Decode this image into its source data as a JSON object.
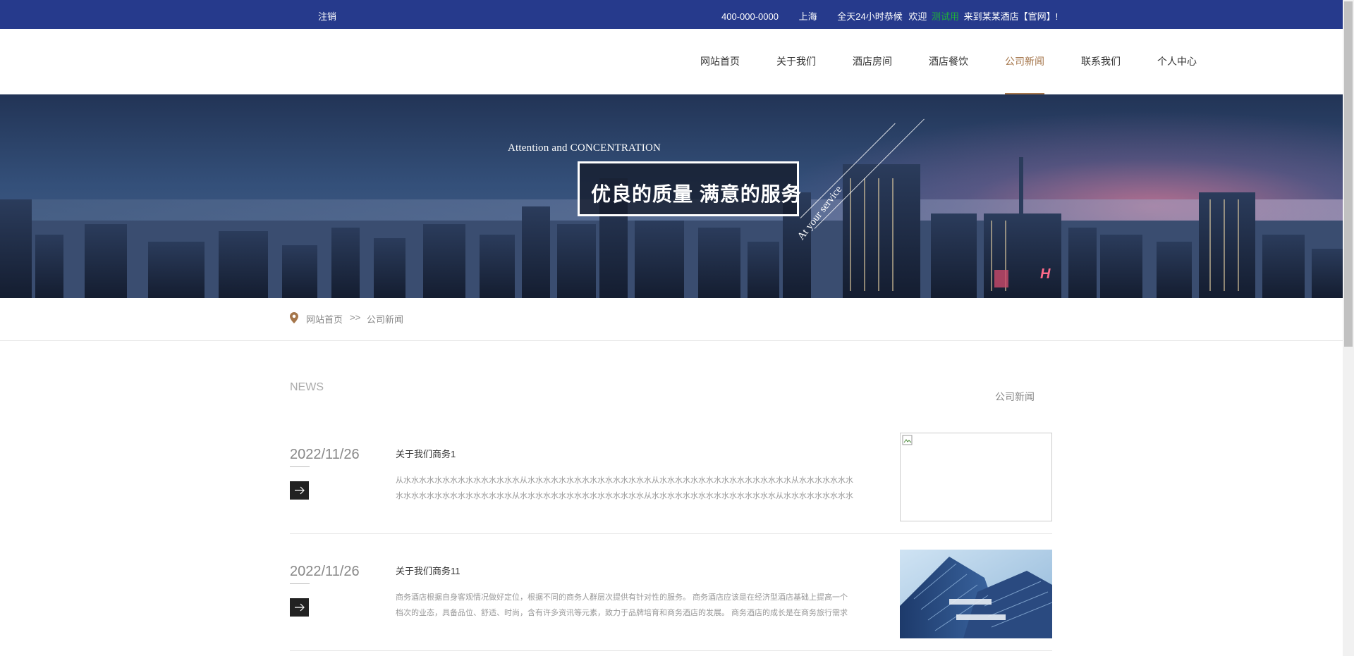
{
  "topbar": {
    "logout": "注销",
    "phone": "400-000-0000",
    "city": "上海",
    "service": "全天24小时恭候",
    "welcome_prefix": "欢迎",
    "username": "测试用",
    "welcome_suffix": "来到某某酒店【官网】!"
  },
  "nav": {
    "items": [
      "网站首页",
      "关于我们",
      "酒店房间",
      "酒店餐饮",
      "公司新闻",
      "联系我们",
      "个人中心"
    ],
    "active": "公司新闻"
  },
  "banner": {
    "tagline": "Attention and CONCENTRATION",
    "slogan": "优良的质量  满意的服务",
    "rotated_text": "At your service"
  },
  "breadcrumb": {
    "home": "网站首页",
    "separator": ">>",
    "current": "公司新闻"
  },
  "news": {
    "label": "NEWS",
    "side_title": "公司新闻",
    "items": [
      {
        "date": "2022/11/26",
        "title": "关于我们商务1",
        "desc": "从水水水水水水水水水水水水水水水从水水水水水水水水水水水水水水水水从水水水水水水水水水水水水水水水水水从水水水水水水水水水水水水水水水水水水水水水水从水水水水水水水水水水水水水水水水从水水水水水水水水水水水水水水水水从水水水水水水水水水水水水水水水水水水水水水水水水水…",
        "image": "broken"
      },
      {
        "date": "2022/11/26",
        "title": "关于我们商务11",
        "desc": "商务酒店根据自身客观情况做好定位，根据不同的商务人群层次提供有针对性的服务。 商务酒店应该是在经济型酒店基础上提高一个档次的业态，具备品位、舒适、时尚，含有许多资讯等元素，致力于品牌培育和商务酒店的发展。 商务酒店的成长是在商务旅行需求引导下…",
        "image": "building"
      }
    ]
  },
  "colors": {
    "topbar": "#263a8c",
    "accent": "#a5764b",
    "username": "#1fae3a"
  }
}
